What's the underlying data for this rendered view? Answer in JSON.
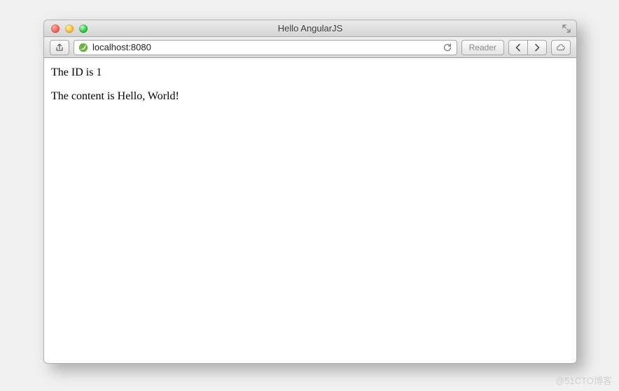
{
  "window": {
    "title": "Hello AngularJS"
  },
  "toolbar": {
    "url": "localhost:8080",
    "reader_label": "Reader"
  },
  "page": {
    "line1": "The ID is 1",
    "line2": "The content is Hello, World!"
  },
  "watermark": "@51CTO博客"
}
